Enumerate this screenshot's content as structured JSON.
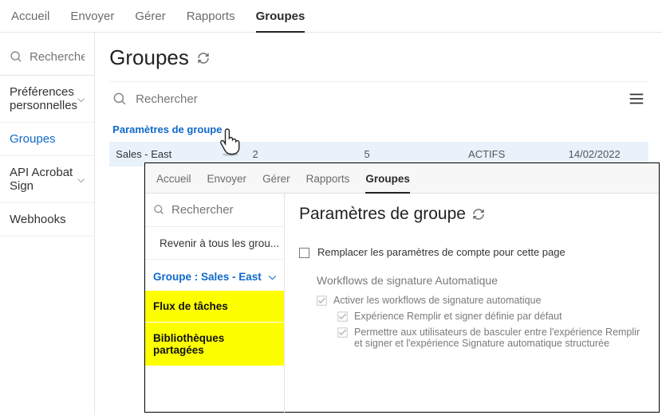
{
  "outer": {
    "tabs": [
      "Accueil",
      "Envoyer",
      "Gérer",
      "Rapports",
      "Groupes"
    ],
    "active_tab": "Groupes",
    "search_placeholder": "Rechercher",
    "sidebar": [
      {
        "label": "Préférences personnelles",
        "chevron": true
      },
      {
        "label": "Groupes",
        "selected": true
      },
      {
        "label": "API Acrobat Sign",
        "chevron": true
      },
      {
        "label": "Webhooks"
      }
    ],
    "page_title": "Groupes",
    "main_search_placeholder": "Rechercher",
    "group_settings_link": "Paramètres de groupe",
    "row": {
      "name": "Sales - East",
      "col_a": "2",
      "col_b": "5",
      "status": "ACTIFS",
      "date": "14/02/2022"
    }
  },
  "inner": {
    "tabs": [
      "Accueil",
      "Envoyer",
      "Gérer",
      "Rapports",
      "Groupes"
    ],
    "active_tab": "Groupes",
    "search_placeholder": "Rechercher",
    "back_label": "Revenir à tous les grou...",
    "group_label": "Groupe : Sales - East",
    "highlighted": [
      "Flux de tâches",
      "Bibliothèques partagées"
    ],
    "title": "Paramètres de groupe",
    "override_label": "Remplacer les paramètres de compte pour cette page",
    "section_title": "Workflows de signature Automatique",
    "options": [
      {
        "text": "Activer les workflows de signature automatique",
        "sub": false
      },
      {
        "text": "Expérience Remplir et signer définie par défaut",
        "sub": true
      },
      {
        "text": "Permettre aux utilisateurs de basculer entre l'expérience Remplir et signer et l'expérience Signature automatique structurée",
        "sub": true
      }
    ]
  }
}
